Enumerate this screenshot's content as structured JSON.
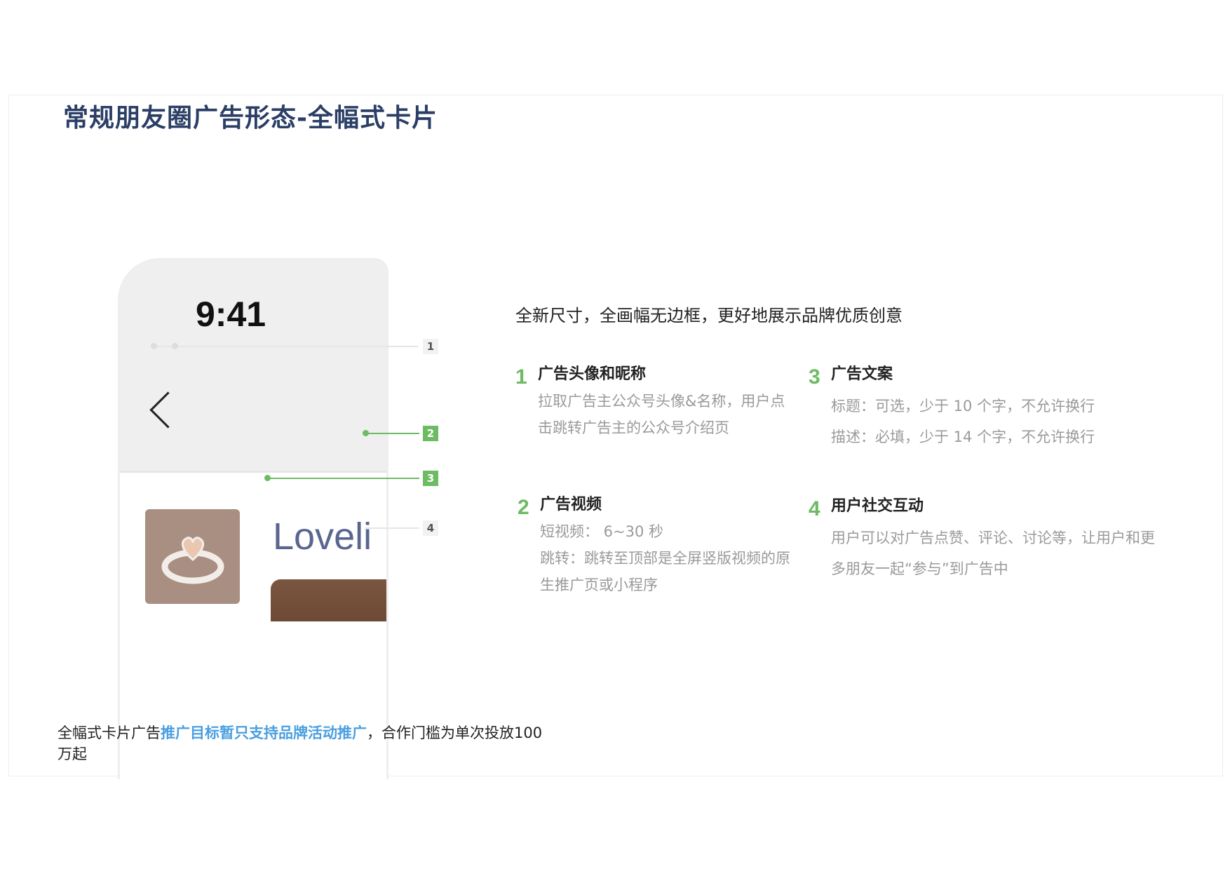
{
  "title": "常规朋友圈广告形态-全幅式卡片",
  "phone": {
    "time": "9:41",
    "brand_name": "Loveli"
  },
  "callouts": [
    "1",
    "2",
    "3",
    "4"
  ],
  "intro": "全新尺寸，全画幅无边框，更好地展示品牌优质创意",
  "items": [
    {
      "num": "1",
      "heading": "广告头像和昵称",
      "lines": [
        "拉取广告主公众号头像&名称，用户点",
        "击跳转广告主的公众号介绍页"
      ]
    },
    {
      "num": "3",
      "heading": "广告文案",
      "lines": [
        "标题：可选，少于 10 个字，不允许换行",
        "描述：必填，少于 14 个字，不允许换行"
      ]
    },
    {
      "num": "2",
      "heading": "广告视频",
      "lines": [
        "短视频： 6~30 秒",
        "跳转：跳转至顶部是全屏竖版视频的原",
        "生推广页或小程序"
      ]
    },
    {
      "num": "4",
      "heading": "用户社交互动",
      "lines": [
        "用户可以对广告点赞、评论、讨论等，让用户和更",
        "多朋友一起“参与”到广告中"
      ]
    }
  ],
  "footer": {
    "prefix": "全幅式卡片广告",
    "highlight": "推广目标暂只支持品牌活动推广",
    "suffix": "，合作门槛为单次投放100",
    "line2": "万起"
  },
  "colors": {
    "title": "#2b3e66",
    "accent_green": "#6dbb63",
    "highlight_blue": "#4a9fe0",
    "muted_text": "#9a9a9a"
  }
}
